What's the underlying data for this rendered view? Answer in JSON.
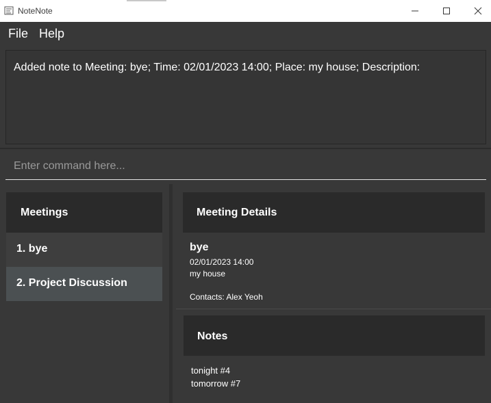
{
  "window": {
    "title": "NoteNote"
  },
  "menu": {
    "file": "File",
    "help": "Help"
  },
  "result": {
    "text": "Added note to Meeting: bye; Time: 02/01/2023 14:00; Place: my house; Description:"
  },
  "command": {
    "placeholder": "Enter command here..."
  },
  "meetings": {
    "header": "Meetings",
    "items": [
      {
        "label": "1.  bye"
      },
      {
        "label": "2.  Project Discussion"
      }
    ]
  },
  "details": {
    "header": "Meeting Details",
    "name": "bye",
    "time": "02/01/2023 14:00",
    "place": "my house",
    "contacts": "Contacts: Alex Yeoh"
  },
  "notes": {
    "header": "Notes",
    "items": [
      "tonight #4",
      "tomorrow #7"
    ]
  },
  "colors": {
    "background": "#383838",
    "header_box": "#2a2a2a",
    "selected_card": "#4b5052",
    "card": "#3e3e3e"
  }
}
